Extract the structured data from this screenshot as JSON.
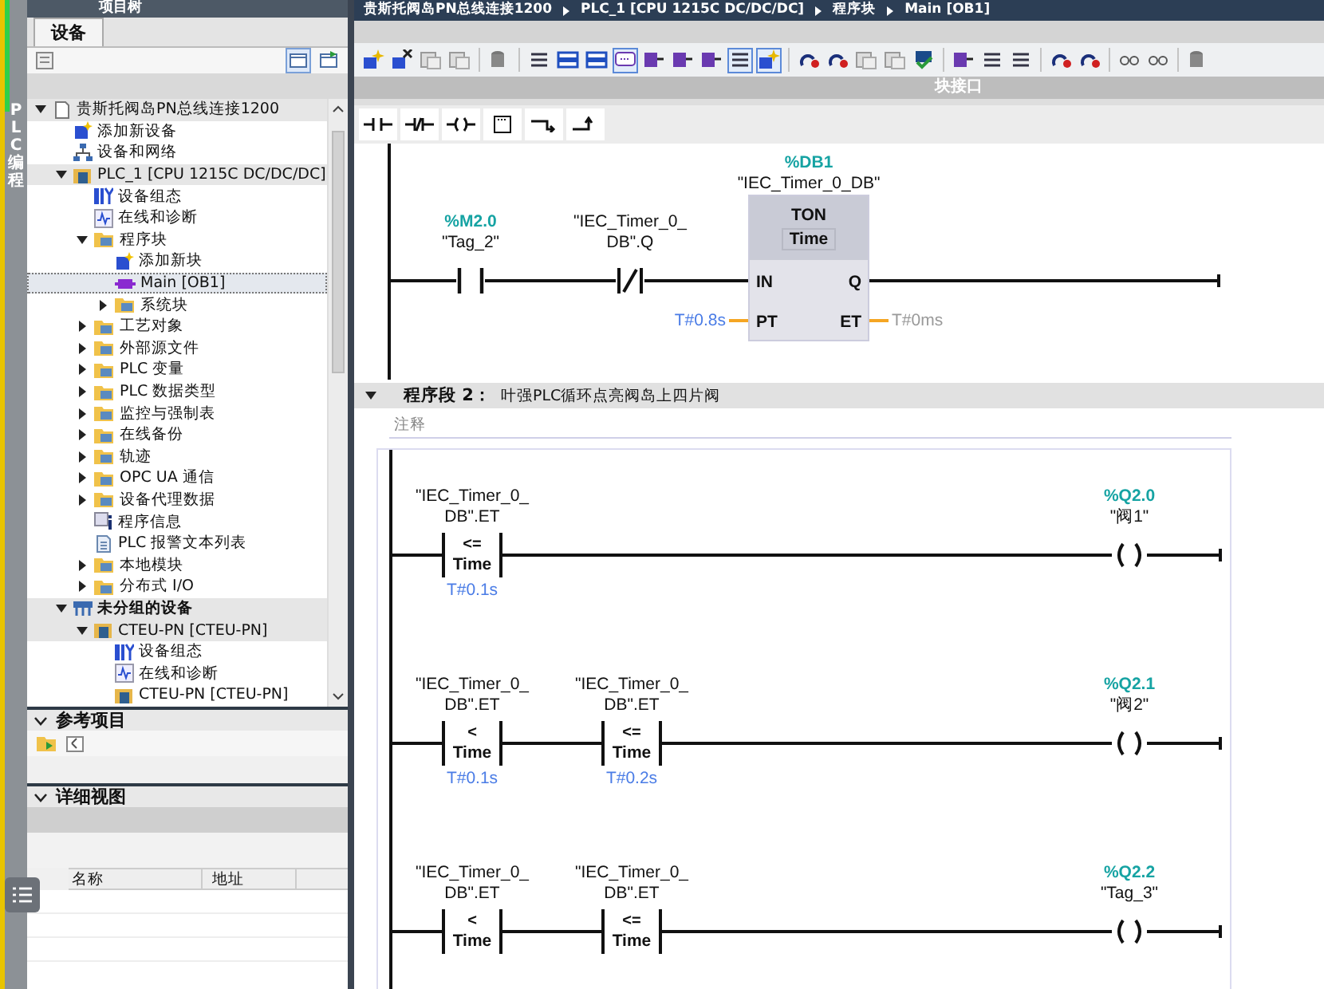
{
  "side_strip": {
    "label": "PLC 编程"
  },
  "project_tree": {
    "title": "项目树",
    "tabs": [
      {
        "label": "设备",
        "selected": true
      }
    ],
    "toolbar": [
      {
        "active": true
      },
      {
        "active": false
      }
    ],
    "items": [
      {
        "label": "贵斯托阀岛PN总线连接1200",
        "kind": "project",
        "expanded": true,
        "selected": false,
        "children": [
          {
            "label": "添加新设备",
            "kind": "add",
            "selected": false
          },
          {
            "label": "设备和网络",
            "kind": "network",
            "selected": false
          },
          {
            "label": "PLC_1 [CPU 1215C DC/DC/DC]",
            "kind": "plc",
            "expanded": true,
            "selected": false,
            "children": [
              {
                "label": "设备组态",
                "kind": "config",
                "selected": false
              },
              {
                "label": "在线和诊断",
                "kind": "diagnostics",
                "selected": false
              },
              {
                "label": "程序块",
                "kind": "folder",
                "expanded": true,
                "selected": false,
                "children": [
                  {
                    "label": "添加新块",
                    "kind": "add",
                    "selected": false
                  },
                  {
                    "label": "Main [OB1]",
                    "kind": "block",
                    "selected": true
                  },
                  {
                    "label": "系统块",
                    "kind": "folder",
                    "expanded": false,
                    "selected": false
                  }
                ]
              },
              {
                "label": "工艺对象",
                "kind": "folder",
                "expanded": false,
                "selected": false
              },
              {
                "label": "外部源文件",
                "kind": "folder",
                "expanded": false,
                "selected": false
              },
              {
                "label": "PLC 变量",
                "kind": "folder",
                "expanded": false,
                "selected": false
              },
              {
                "label": "PLC 数据类型",
                "kind": "folder",
                "expanded": false,
                "selected": false
              },
              {
                "label": "监控与强制表",
                "kind": "folder",
                "expanded": false,
                "selected": false
              },
              {
                "label": "在线备份",
                "kind": "folder",
                "expanded": false,
                "selected": false
              },
              {
                "label": "轨迹",
                "kind": "folder",
                "expanded": false,
                "selected": false
              },
              {
                "label": "OPC UA 通信",
                "kind": "folder",
                "expanded": false,
                "selected": false
              },
              {
                "label": "设备代理数据",
                "kind": "folder",
                "expanded": false,
                "selected": false
              },
              {
                "label": "程序信息",
                "kind": "info",
                "selected": false
              },
              {
                "label": "PLC 报警文本列表",
                "kind": "document",
                "selected": false
              },
              {
                "label": "本地模块",
                "kind": "folder",
                "expanded": false,
                "selected": false
              },
              {
                "label": "分布式 I/O",
                "kind": "folder",
                "expanded": false,
                "selected": false
              }
            ]
          },
          {
            "label": "未分组的设备",
            "kind": "group",
            "expanded": true,
            "selected": false,
            "children": [
              {
                "label": "CTEU-PN [CTEU-PN]",
                "kind": "plc",
                "expanded": true,
                "selected": false,
                "children": [
                  {
                    "label": "设备组态",
                    "kind": "config",
                    "selected": false
                  },
                  {
                    "label": "在线和诊断",
                    "kind": "diagnostics",
                    "selected": false
                  },
                  {
                    "label": "CTEU-PN [CTEU-PN]",
                    "kind": "device",
                    "selected": false
                  }
                ]
              }
            ]
          }
        ]
      }
    ]
  },
  "reference_projects": {
    "title": "参考项目"
  },
  "details_view": {
    "title": "详细视图",
    "columns": [
      "名称",
      "地址"
    ]
  },
  "breadcrumb": [
    "贵斯托阀岛PN总线连接1200",
    "PLC_1 [CPU 1215C DC/DC/DC]",
    "程序块",
    "Main [OB1]"
  ],
  "editor_toolbar": [
    {
      "active": false
    },
    {
      "active": false
    },
    {
      "active": false
    },
    {
      "active": false
    },
    {
      "active": false
    },
    {
      "active": false
    },
    {
      "active": false
    },
    {
      "active": false
    },
    {
      "active": true
    },
    {
      "active": false
    },
    {
      "active": false
    },
    {
      "active": false
    },
    {
      "active": true
    },
    {
      "active": true
    },
    {
      "active": false
    },
    {
      "active": false
    },
    {
      "active": false
    },
    {
      "active": false
    },
    {
      "active": false
    },
    {
      "active": false
    },
    {
      "active": false
    },
    {
      "active": false
    },
    {
      "active": false
    },
    {
      "active": false
    },
    {
      "active": false
    },
    {
      "active": false
    },
    {
      "active": false
    }
  ],
  "block_interface": {
    "label": "块接口"
  },
  "network_1": {
    "rungs": [
      {
        "elements": [
          {
            "kind": "contact_no",
            "address": "%M2.0",
            "operand": "\"Tag_2\""
          },
          {
            "kind": "contact_nc",
            "operand": "\"IEC_Timer_0_\nDB\".Q"
          },
          {
            "kind": "timer",
            "address": "%DB1",
            "instance": "\"IEC_Timer_0_DB\"",
            "name": "TON",
            "data_type": "Time",
            "pins_in": [
              {
                "name": "IN"
              },
              {
                "name": "PT",
                "value": "T#0.8s"
              }
            ],
            "pins_out": [
              {
                "name": "Q"
              },
              {
                "name": "ET",
                "value": "T#0ms"
              }
            ]
          }
        ]
      }
    ]
  },
  "network_2": {
    "number": "程序段 2：",
    "title": "叶强PLC循环点亮阀岛上四片阀",
    "comment_placeholder": "注释",
    "rungs": [
      {
        "elements": [
          {
            "kind": "compare",
            "operator": "<=",
            "data_type": "Time",
            "operand": "\"IEC_Timer_0_\nDB\".ET",
            "value": "T#0.1s"
          },
          {
            "kind": "coil",
            "address": "%Q2.0",
            "operand": "\"阀1\""
          }
        ]
      },
      {
        "elements": [
          {
            "kind": "compare",
            "operator": "<",
            "data_type": "Time",
            "operand": "\"IEC_Timer_0_\nDB\".ET",
            "value": "T#0.1s"
          },
          {
            "kind": "compare",
            "operator": "<=",
            "data_type": "Time",
            "operand": "\"IEC_Timer_0_\nDB\".ET",
            "value": "T#0.2s"
          },
          {
            "kind": "coil",
            "address": "%Q2.1",
            "operand": "\"阀2\""
          }
        ]
      },
      {
        "elements": [
          {
            "kind": "compare",
            "operator": "<",
            "data_type": "Time",
            "operand": "\"IEC_Timer_0_\nDB\".ET"
          },
          {
            "kind": "compare",
            "operator": "<=",
            "data_type": "Time",
            "operand": "\"IEC_Timer_0_\nDB\".ET"
          },
          {
            "kind": "coil",
            "address": "%Q2.2",
            "operand": "\"Tag_3\""
          }
        ]
      }
    ]
  }
}
